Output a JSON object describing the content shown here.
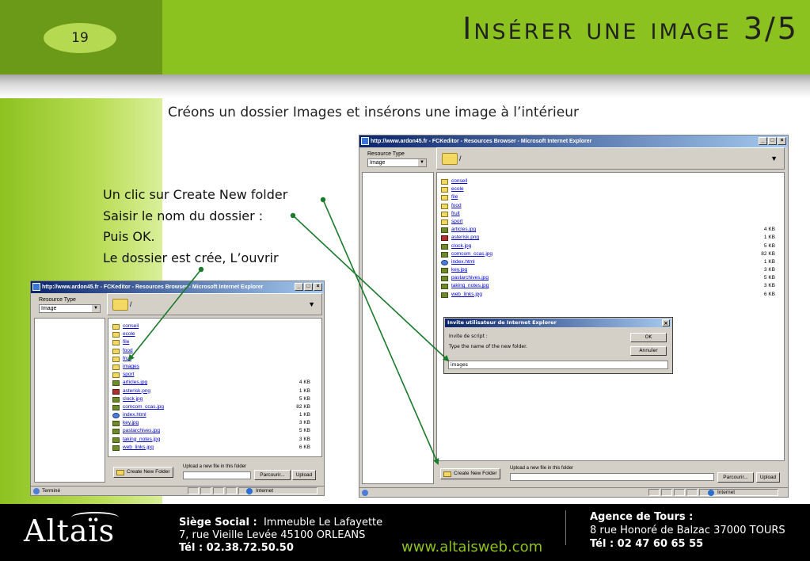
{
  "slide": {
    "page_number": "19",
    "title": "Insérer une image 3/5",
    "subtitle": "Créons un dossier Images et insérons une image à l’intérieur",
    "instructions": [
      "Un clic sur Create New folder",
      "Saisir le nom du dossier :",
      "Puis OK.",
      "Le dossier est crée, L’ouvrir"
    ]
  },
  "colors": {
    "header_dark": "#6a9a18",
    "header_light": "#8cc220",
    "arrow": "#1a7a2a",
    "link": "#0000cc"
  },
  "small_window": {
    "title": "http://www.ardon45.fr - FCKeditor - Resources Browser - Microsoft Internet Explorer",
    "resource_type_label": "Resource Type",
    "resource_type_value": "Image",
    "path": "/",
    "files": [
      {
        "name": "conseil",
        "type": "folder",
        "size": ""
      },
      {
        "name": "ecole",
        "type": "folder",
        "size": ""
      },
      {
        "name": "file",
        "type": "folder",
        "size": ""
      },
      {
        "name": "food",
        "type": "folder",
        "size": ""
      },
      {
        "name": "fruit",
        "type": "folder",
        "size": ""
      },
      {
        "name": "images",
        "type": "folder",
        "size": ""
      },
      {
        "name": "sport",
        "type": "folder",
        "size": ""
      },
      {
        "name": "articles.jpg",
        "type": "img",
        "size": "4 KB"
      },
      {
        "name": "asterisk.png",
        "type": "png",
        "size": "1 KB"
      },
      {
        "name": "clock.jpg",
        "type": "img",
        "size": "5 KB"
      },
      {
        "name": "comcom_ccas.jpg",
        "type": "img",
        "size": "82 KB"
      },
      {
        "name": "index.html",
        "type": "html",
        "size": "1 KB"
      },
      {
        "name": "key.jpg",
        "type": "img",
        "size": "3 KB"
      },
      {
        "name": "pastarchives.jpg",
        "type": "img",
        "size": "5 KB"
      },
      {
        "name": "taking_notes.jpg",
        "type": "img",
        "size": "3 KB"
      },
      {
        "name": "web_links.jpg",
        "type": "img",
        "size": "6 KB"
      }
    ],
    "create_folder_label": "Create New Folder",
    "upload_label": "Upload a new file in this folder",
    "browse_label": "Parcourir...",
    "upload_button": "Upload",
    "status_text": "Terminé",
    "zone_text": "Internet"
  },
  "large_window": {
    "title": "http://www.ardon45.fr - FCKeditor - Resources Browser - Microsoft Internet Explorer",
    "resource_type_label": "Resource Type",
    "resource_type_value": "Image",
    "path": "/",
    "files": [
      {
        "name": "conseil",
        "type": "folder",
        "size": ""
      },
      {
        "name": "ecole",
        "type": "folder",
        "size": ""
      },
      {
        "name": "file",
        "type": "folder",
        "size": ""
      },
      {
        "name": "food",
        "type": "folder",
        "size": ""
      },
      {
        "name": "fruit",
        "type": "folder",
        "size": ""
      },
      {
        "name": "sport",
        "type": "folder",
        "size": ""
      },
      {
        "name": "articles.jpg",
        "type": "img",
        "size": "4 KB"
      },
      {
        "name": "asterisk.png",
        "type": "png",
        "size": "1 KB"
      },
      {
        "name": "clock.jpg",
        "type": "img",
        "size": "5 KB"
      },
      {
        "name": "comcom_ccas.jpg",
        "type": "img",
        "size": "82 KB"
      },
      {
        "name": "index.html",
        "type": "html",
        "size": "1 KB"
      },
      {
        "name": "key.jpg",
        "type": "img",
        "size": "3 KB"
      },
      {
        "name": "pastarchives.jpg",
        "type": "img",
        "size": "5 KB"
      },
      {
        "name": "taking_notes.jpg",
        "type": "img",
        "size": "3 KB"
      },
      {
        "name": "web_links.jpg",
        "type": "img",
        "size": "6 KB"
      }
    ],
    "create_folder_label": "Create New Folder",
    "upload_label": "Upload a new file in this folder",
    "browse_label": "Parcourir...",
    "upload_button": "Upload",
    "zone_text": "Internet"
  },
  "dialog": {
    "title": "Invite utilisateur de Internet Explorer",
    "script_label": "Invite de script :",
    "prompt_text": "Type the name of the new folder.",
    "input_value": "images",
    "ok_label": "OK",
    "cancel_label": "Annuler",
    "close_glyph": "×"
  },
  "footer": {
    "logo": "Altaïs",
    "siege_label": "Siège Social :",
    "siege_value": "Immeuble Le Lafayette",
    "siege_address": "7, rue Vieille Levée 45100 ORLEANS",
    "siege_tel": "Tél : 02.38.72.50.50",
    "website": "www.altaisweb.com",
    "agence_label": "Agence de Tours :",
    "agence_address": "8 rue Honoré de Balzac  37000 TOURS",
    "agence_tel": "Tél : 02 47 60 65 55"
  }
}
